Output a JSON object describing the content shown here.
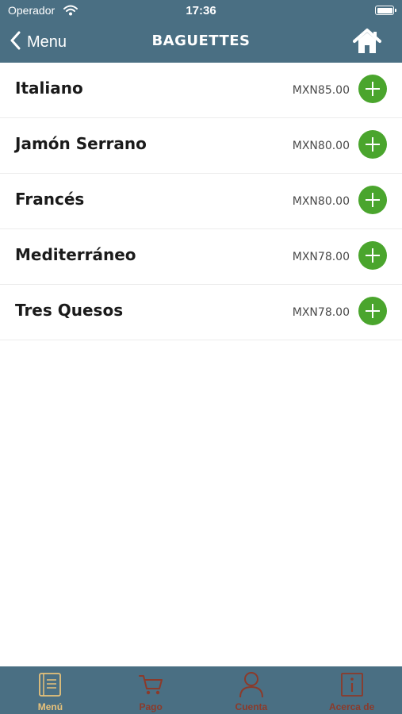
{
  "status_bar": {
    "carrier": "Operador",
    "time": "17:36"
  },
  "nav": {
    "back_label": "Menu",
    "title": "BAGUETTES"
  },
  "items": [
    {
      "name": "Italiano",
      "price": "MXN85.00"
    },
    {
      "name": "Jamón Serrano",
      "price": "MXN80.00"
    },
    {
      "name": "Francés",
      "price": "MXN80.00"
    },
    {
      "name": "Mediterráneo",
      "price": "MXN78.00"
    },
    {
      "name": "Tres Quesos",
      "price": "MXN78.00"
    }
  ],
  "tabs": [
    {
      "label": "Menú",
      "icon": "menu-book-icon",
      "active": true
    },
    {
      "label": "Pago",
      "icon": "cart-icon",
      "active": false
    },
    {
      "label": "Cuenta",
      "icon": "user-icon",
      "active": false
    },
    {
      "label": "Acerca de",
      "icon": "info-icon",
      "active": false
    }
  ],
  "colors": {
    "header_bg": "#4a6f83",
    "add_button": "#4aa52d",
    "tab_active": "#e8c27a",
    "tab_inactive": "#8c3a2a"
  }
}
